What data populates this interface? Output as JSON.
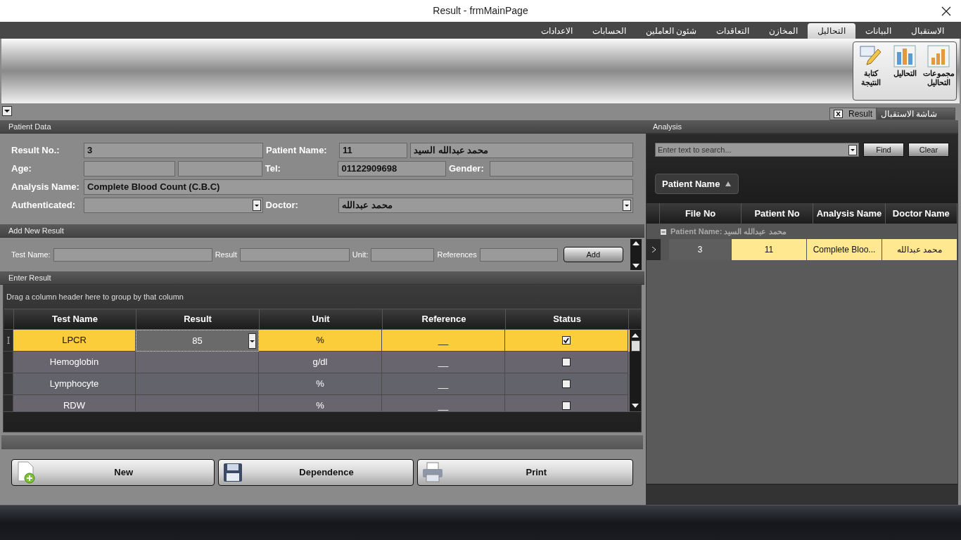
{
  "window": {
    "title": "Result - frmMainPage"
  },
  "ribbon_tabs": [
    {
      "label": "الاستقبال",
      "selected": false
    },
    {
      "label": "البيانات",
      "selected": false
    },
    {
      "label": "التحاليل",
      "selected": true
    },
    {
      "label": "المخازن",
      "selected": false
    },
    {
      "label": "التعاقدات",
      "selected": false
    },
    {
      "label": "شئون العاملين",
      "selected": false
    },
    {
      "label": "الحسابات",
      "selected": false
    },
    {
      "label": "الاعدادات",
      "selected": false
    }
  ],
  "ribbon_buttons": [
    {
      "label": "مجموعات التحاليل",
      "kind": "bars"
    },
    {
      "label": "التحاليل",
      "kind": "columns"
    },
    {
      "label": "كتابة النتيجة",
      "kind": "write"
    }
  ],
  "document_tabs": [
    {
      "label": "Result",
      "selected": true,
      "closable": true
    },
    {
      "label": "شاشة الاستقبال",
      "selected": false,
      "closable": false
    }
  ],
  "patient_data": {
    "title": "Patient Data",
    "result_no": {
      "label": "Result No.:",
      "value": "3"
    },
    "patient_name": {
      "label": "Patient Name:",
      "number": "11",
      "name": "محمد عبدالله السيد"
    },
    "age": {
      "label": "Age:"
    },
    "tel": {
      "label": "Tel:",
      "value": "01122909698"
    },
    "gender": {
      "label": "Gender:"
    },
    "analysis_name": {
      "label": "Analysis Name:",
      "value": "Complete Blood Count (C.B.C)"
    },
    "authenticated": {
      "label": "Authenticated:"
    },
    "doctor": {
      "label": "Doctor:",
      "value": "محمد عبدالله"
    }
  },
  "add_new_result": {
    "title": "Add New Result",
    "fields": [
      {
        "label": "Test Name:"
      },
      {
        "label": "Result"
      },
      {
        "label": "Unit:"
      },
      {
        "label": "References"
      }
    ],
    "button": "Add"
  },
  "enter_result": {
    "title": "Enter Result",
    "group_hint": "Drag a column header here to group by that column",
    "columns": [
      "Test Name",
      "Result",
      "Unit",
      "Reference",
      "Status"
    ],
    "rows": [
      {
        "test": "LPCR",
        "result": "85",
        "unit": "%",
        "reference": "__",
        "checked": true,
        "selected": true
      },
      {
        "test": "Hemoglobin",
        "unit": "g/dl",
        "reference": "__",
        "checked": false,
        "selected": false
      },
      {
        "test": "Lymphocyte",
        "unit": "%",
        "reference": "__",
        "checked": false,
        "selected": false
      },
      {
        "test": "RDW",
        "unit": "%",
        "reference": "__",
        "checked": false,
        "selected": false
      }
    ]
  },
  "actions": [
    {
      "label": "New",
      "kind": "new"
    },
    {
      "label": "Dependence",
      "kind": "save"
    },
    {
      "label": "Print",
      "kind": "print"
    }
  ],
  "analysis": {
    "title": "Analysis",
    "search_placeholder": "Enter text to search...",
    "find": "Find",
    "clear": "Clear",
    "group_by": "Patient Name",
    "columns": [
      "File No",
      "Patient No",
      "Analysis Name",
      "Doctor Name"
    ],
    "groups": [
      {
        "label": "Patient Name: محمد عبدالله السيد",
        "expanded": true,
        "rows": [
          {
            "cells": [
              "3",
              "11",
              "Complete Bloo...",
              "محمد عبدالله"
            ],
            "selected": true
          }
        ]
      }
    ]
  }
}
